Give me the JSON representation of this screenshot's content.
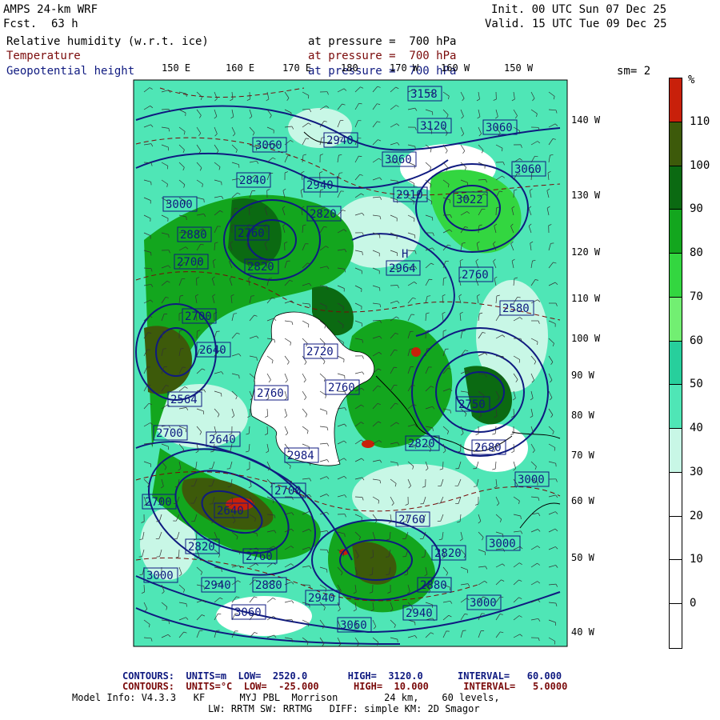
{
  "header": {
    "model": "AMPS 24-km WRF",
    "fcst_label": "Fcst.",
    "fcst_value": "63 h",
    "init": "Init. 00 UTC Sun 07 Dec 25",
    "valid": "Valid. 15 UTC Tue 09 Dec 25"
  },
  "fields": [
    {
      "name": "Relative humidity (w.r.t. ice)",
      "level": "at pressure =  700 hPa",
      "color": "#000000"
    },
    {
      "name": "Temperature",
      "level": "at pressure =  700 hPa",
      "color": "#7a0a0a"
    },
    {
      "name": "Geopotential height",
      "level": "at pressure =  700 hPa",
      "color": "#0f1a80"
    }
  ],
  "smoothing": "sm= 2",
  "top_longitudes": [
    "150 E",
    "160 E",
    "170 E",
    "180",
    "170 W",
    "160 W",
    "150 W"
  ],
  "right_longitudes": [
    "140 W",
    "130 W",
    "120 W",
    "110 W",
    "100 W",
    "90 W",
    "80 W",
    "70 W",
    "60 W",
    "50 W",
    "40 W"
  ],
  "legend": {
    "unit": "%",
    "labels": [
      "110",
      "100",
      "90",
      "80",
      "70",
      "60",
      "50",
      "40",
      "30",
      "20",
      "10",
      "0"
    ],
    "colors": [
      "#c8200a",
      "#3d5a0a",
      "#0b6a12",
      "#13a61e",
      "#33d640",
      "#72ef72",
      "#27cf9c",
      "#4fe6b6",
      "#c8f7e6",
      "#ffffff",
      "#ffffff",
      "#ffffff",
      "#ffffff"
    ]
  },
  "height_labels": [
    "3158",
    "3120",
    "3060",
    "3060",
    "2940",
    "3060",
    "3060",
    "2910",
    "3022",
    "2840",
    "2820",
    "2940",
    "3000",
    "2880",
    "2760",
    "2700",
    "2820",
    "2964",
    "2760",
    "2580",
    "2700",
    "2640",
    "2720",
    "2760",
    "2564",
    "2760",
    "2750",
    "2700",
    "2640",
    "2820",
    "2700",
    "2984",
    "2700",
    "2680",
    "2760",
    "2820",
    "2820",
    "2760",
    "3000",
    "2940",
    "3000",
    "2880",
    "3000",
    "3000",
    "3060",
    "2940",
    "3060",
    "2640",
    "2880",
    "2940"
  ],
  "footer": {
    "height_contours": "CONTOURS:  UNITS=m  LOW=  2520.0       HIGH=  3120.0      INTERVAL=   60.000",
    "temp_contours": "CONTOURS:  UNITS=°C  LOW=  -25.000      HIGH=  10.000      INTERVAL=   5.0000",
    "model_info": "Model Info: V4.3.3   KF      MYJ PBL  Morrison        24 km,    60 levels,",
    "physics": "LW: RRTM SW: RRTMG   DIFF: simple KM: 2D Smagor"
  }
}
